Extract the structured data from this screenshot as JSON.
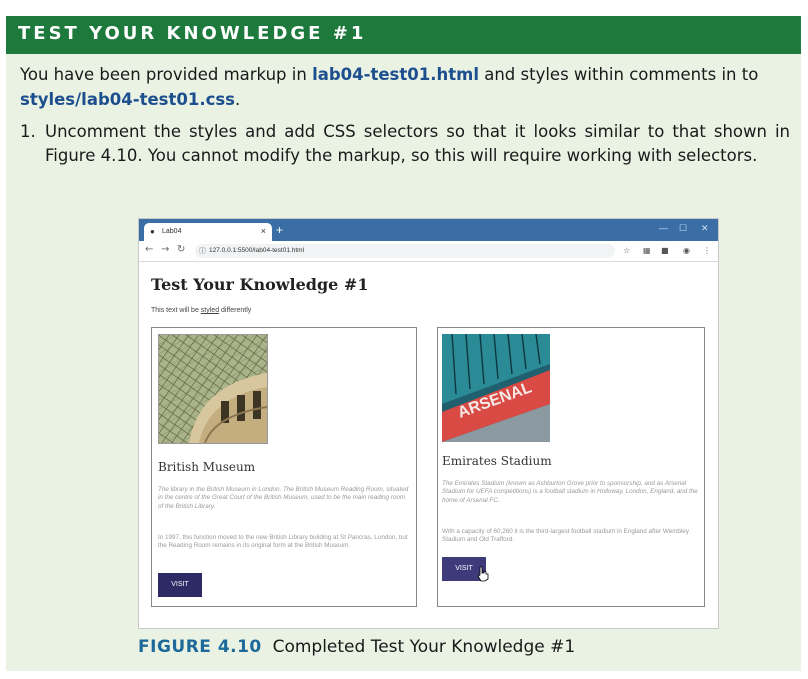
{
  "header": {
    "title": "TEST YOUR KNOWLEDGE #1"
  },
  "intro": {
    "part1": "You have been provided markup in ",
    "file1": "lab04-test01.html",
    "part2": " and styles within comments in to ",
    "file2": "styles/lab04-test01.css",
    "part3": "."
  },
  "steps": [
    {
      "num": "1.",
      "text": "Uncomment the styles and add CSS selectors so that it looks similar to that shown in Figure 4.10. You cannot modify the markup, so this will require working with selectors."
    }
  ],
  "browser": {
    "tab_title": "Lab04",
    "tab_close": "×",
    "new_tab": "+",
    "url": "127.0.0.1:5500/lab04-test01.html",
    "page": {
      "heading": "Test Your Knowledge #1",
      "subtext_before": "This text will be ",
      "subtext_link": "styled",
      "subtext_after": " differently",
      "cards": [
        {
          "title": "British Museum",
          "desc": "The library in the British Museum in London. The British Museum Reading Room, situated in the centre of the Great Court of the British Museum, used to be the main reading room of the British Library.",
          "body": "In 1997, this function moved to the new British Library building at St Pancras, London, but the Reading Room remains in its original form at the British Museum.",
          "button": "VISIT"
        },
        {
          "title": "Emirates Stadium",
          "desc": "The Emirates Stadium (known as Ashburton Grove prior to sponsorship, and as Arsenal Stadium for UEFA competitions) is a football stadium in Holloway, London, England, and the home of Arsenal FC.",
          "body": "With a capacity of 60,260 it is the third-largest football stadium in England after Wembley Stadium and Old Trafford.",
          "button": "VISIT",
          "sign_text": "ARSENAL"
        }
      ]
    }
  },
  "caption": {
    "label": "FIGURE 4.10",
    "text": "Completed Test Your Knowledge #1"
  },
  "colors": {
    "header_green": "#1e7a3c",
    "panel_bg": "#e9f2e3",
    "file_blue": "#1d4f8f",
    "button": "#2e2a66",
    "caption_blue": "#1d6a9a"
  }
}
